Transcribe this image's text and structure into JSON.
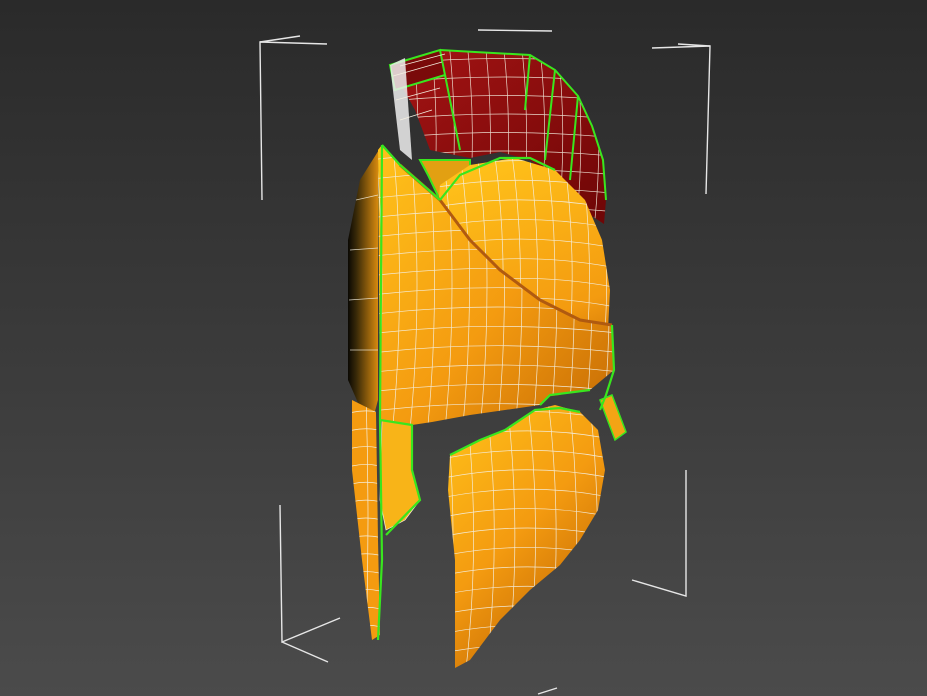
{
  "viewport": {
    "background_top": "#2a2a2a",
    "background_bottom": "#4b4b4b",
    "selection_bracket_color": "#e6e6e6"
  },
  "model": {
    "selection_edge_color": "#39e61e",
    "wire_color": "#f4efe0",
    "helmet_light": "#ffc21a",
    "helmet_mid": "#f49b10",
    "helmet_dark": "#c46a04",
    "crest_light": "#a51414",
    "crest_dark": "#6e0606"
  }
}
